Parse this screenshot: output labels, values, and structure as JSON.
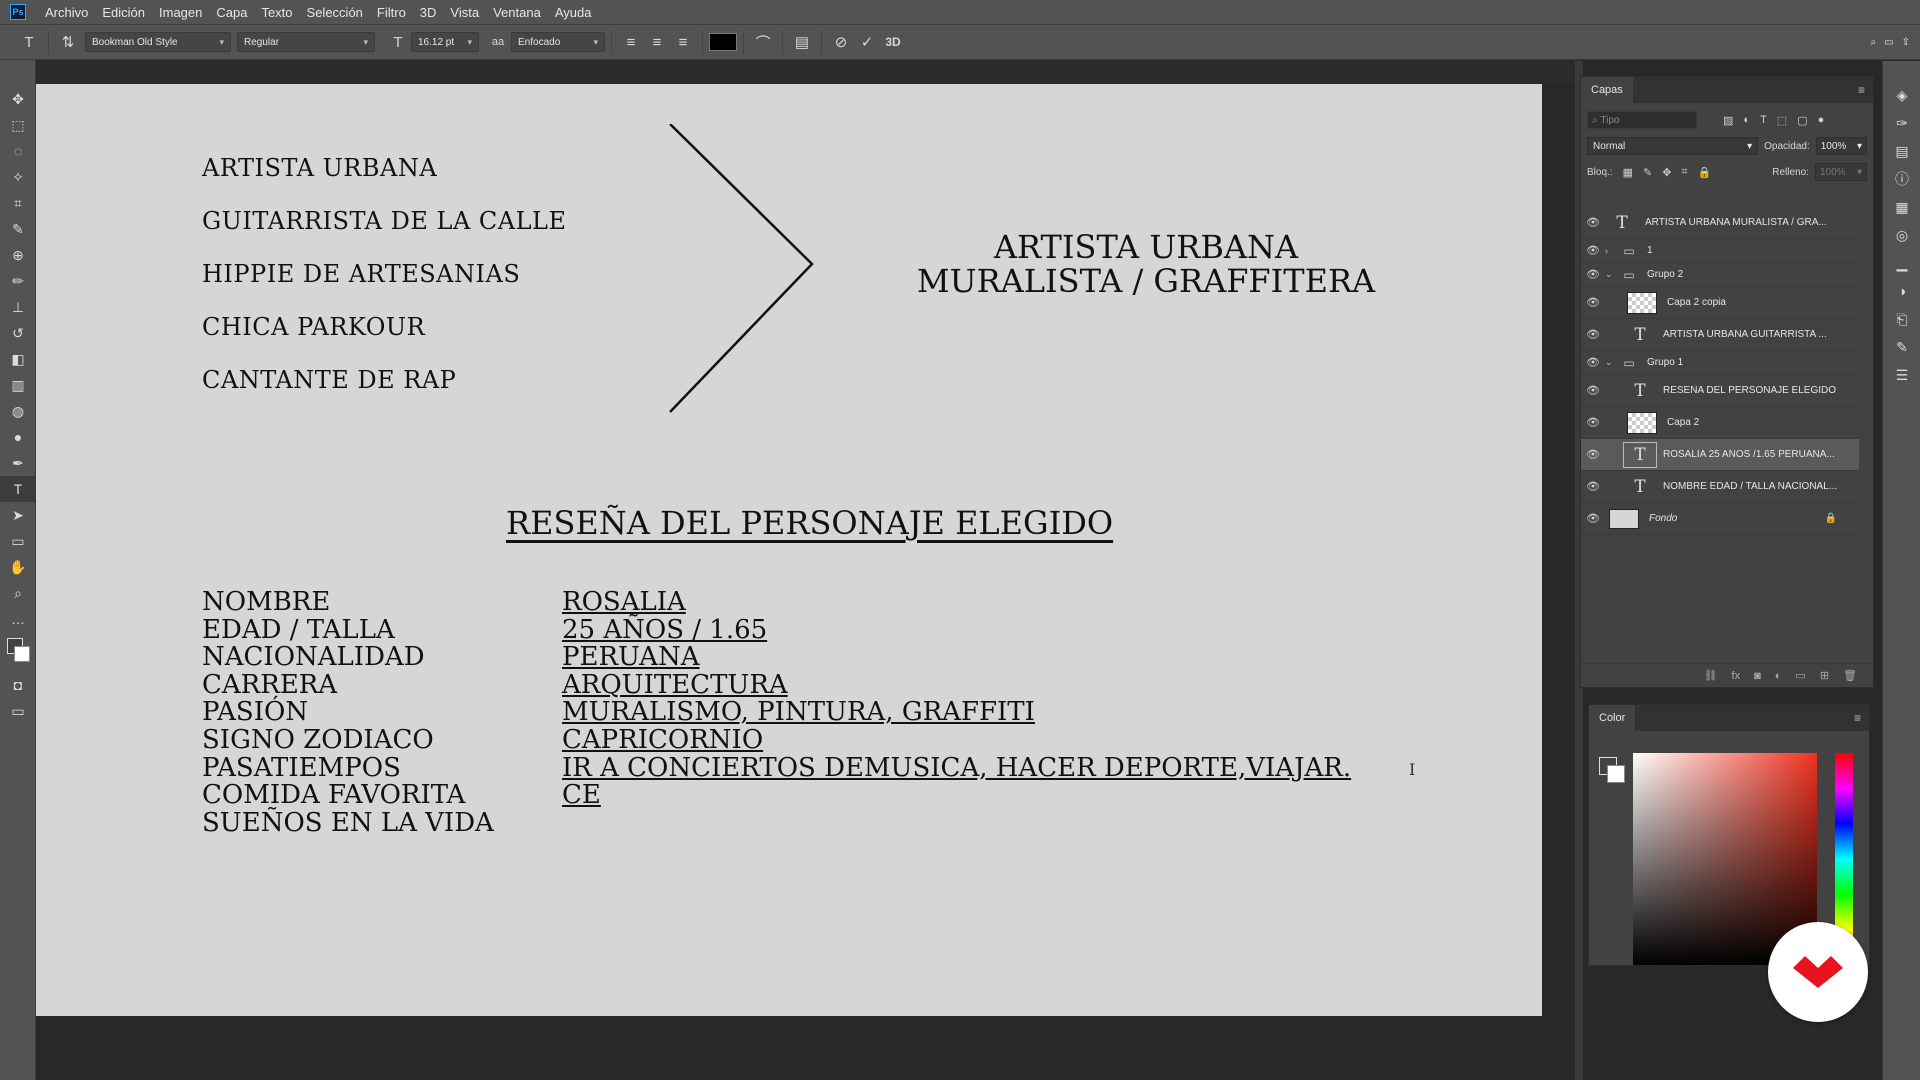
{
  "menu": {
    "items": [
      "Archivo",
      "Edición",
      "Imagen",
      "Capa",
      "Texto",
      "Selección",
      "Filtro",
      "3D",
      "Vista",
      "Ventana",
      "Ayuda"
    ]
  },
  "options_bar": {
    "font_family": "Bookman Old Style",
    "font_style": "Regular",
    "font_size": "16.12 pt",
    "antialias": "Enfocado",
    "color": "#000000",
    "three_d_label": "3D"
  },
  "canvas": {
    "character_list": [
      "ARTISTA URBANA",
      "GUITARRISTA DE LA CALLE",
      "HIPPIE DE ARTESANIAS",
      "CHICA PARKOUR",
      "CANTANTE DE RAP"
    ],
    "result_line1": "ARTISTA URBANA",
    "result_line2": "MURALISTA / GRAFFITERA",
    "section_title": "RESEÑA DEL PERSONAJE ELEGIDO",
    "labels": [
      "NOMBRE",
      "EDAD / TALLA",
      "NACIONALIDAD",
      "CARRERA",
      "PASIÓN",
      "SIGNO ZODIACO",
      "PASATIEMPOS",
      "COMIDA FAVORITA",
      "SUEÑOS EN LA VIDA"
    ],
    "values": [
      "ROSALIA",
      "25 AÑOS / 1.65",
      "PERUANA",
      "ARQUITECTURA",
      "MURALISMO, PINTURA, GRAFFITI",
      "CAPRICORNIO",
      "IR A CONCIERTOS DEMUSICA, HACER DEPORTE,VIAJAR.",
      "CE"
    ]
  },
  "layers_panel": {
    "tab": "Capas",
    "filter_placeholder": "Tipo",
    "blend_mode": "Normal",
    "opacity_label": "Opacidad:",
    "opacity_value": "100%",
    "lock_label": "Bloq.:",
    "fill_label": "Relleno:",
    "fill_value": "100%",
    "layers": [
      {
        "name": "ARTISTA URBANA  MURALISTA / GRA...",
        "kind": "text"
      },
      {
        "name": "1",
        "kind": "group"
      },
      {
        "name": "Grupo 2",
        "kind": "group"
      },
      {
        "name": "Capa 2 copia",
        "kind": "image"
      },
      {
        "name": "ARTISTA URBANA  GUITARRISTA ...",
        "kind": "text"
      },
      {
        "name": "Grupo 1",
        "kind": "group"
      },
      {
        "name": "RESEÑA DEL PERSONAJE ELEGIDO",
        "kind": "text"
      },
      {
        "name": "Capa 2",
        "kind": "image"
      },
      {
        "name": "ROSALIA 25 AÑOS /1.65 PERUANA...",
        "kind": "text",
        "selected": true
      },
      {
        "name": "NOMBRE EDAD / TALLA NACIONAL...",
        "kind": "text"
      },
      {
        "name": "Fondo",
        "kind": "background",
        "locked": true
      }
    ]
  },
  "color_panel": {
    "tab": "Color",
    "hue_color": "#f1311f"
  },
  "brand": {
    "accent": "#e8131e"
  }
}
